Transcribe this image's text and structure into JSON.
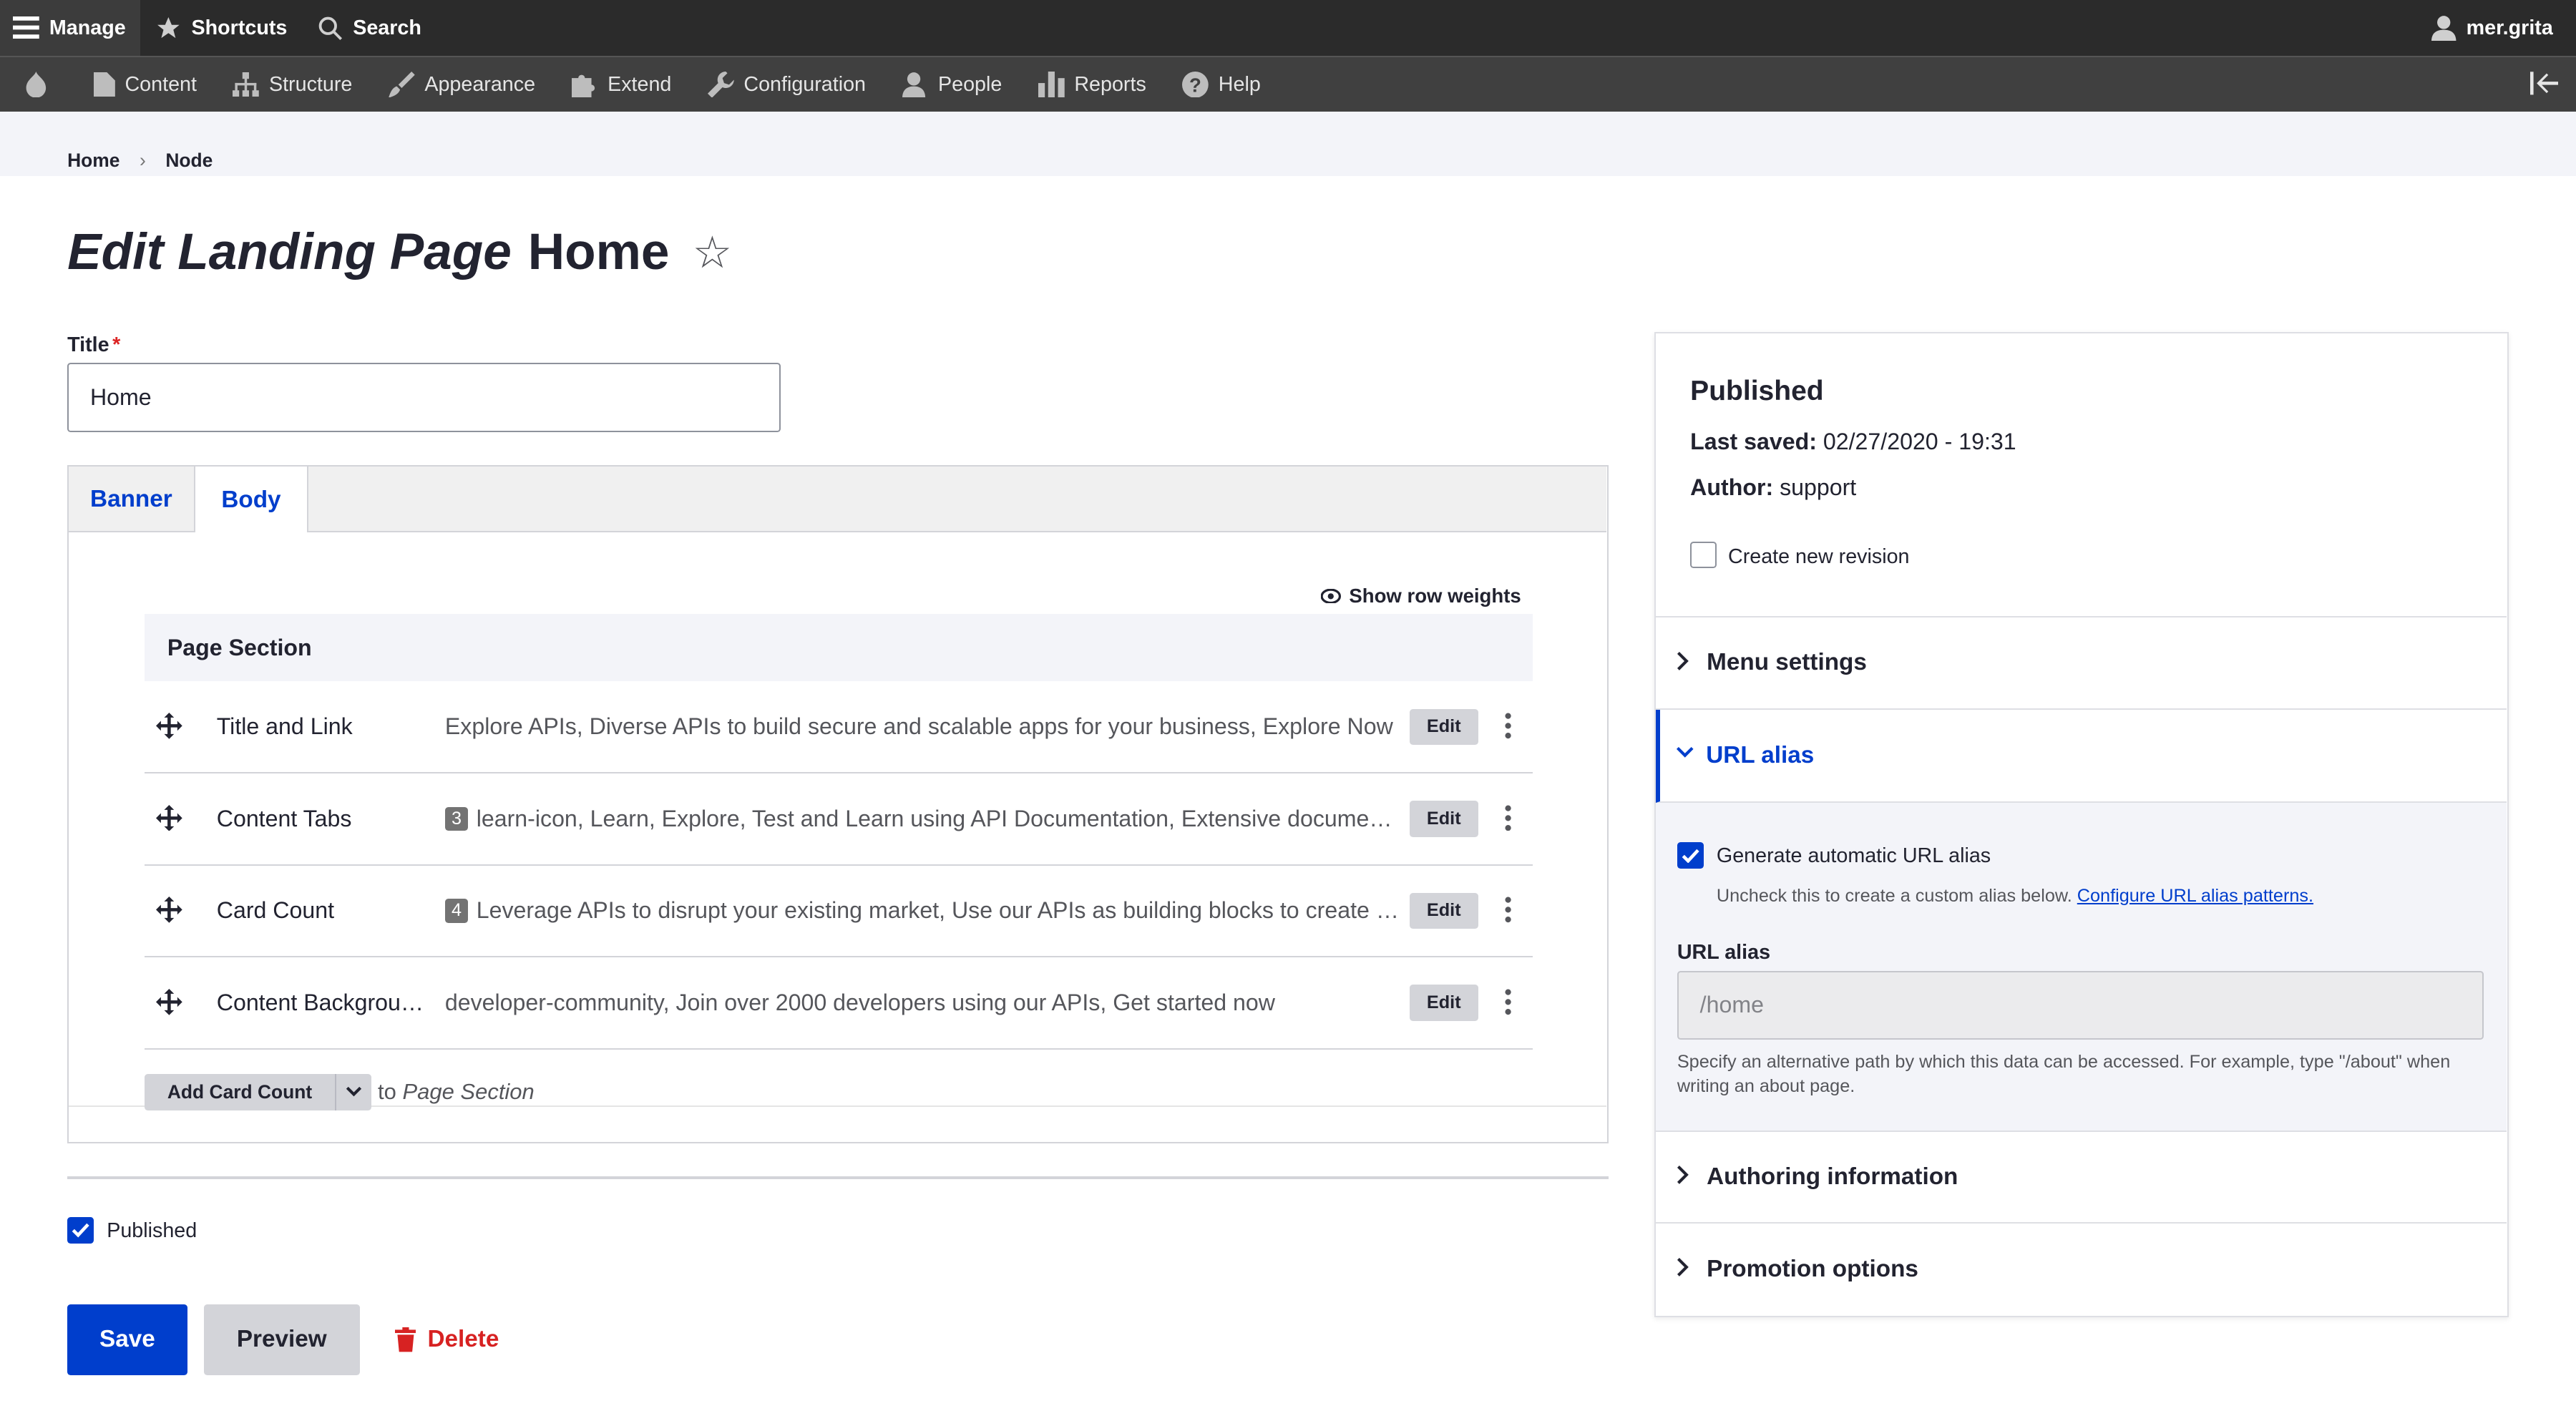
{
  "toolbar": {
    "manage": "Manage",
    "shortcuts": "Shortcuts",
    "search": "Search",
    "user": "mer.grita"
  },
  "admin_menu": [
    "Content",
    "Structure",
    "Appearance",
    "Extend",
    "Configuration",
    "People",
    "Reports",
    "Help"
  ],
  "breadcrumb": [
    "Home",
    "Node"
  ],
  "page_title": {
    "emphasis": "Edit Landing Page",
    "name": "Home"
  },
  "title_field": {
    "label": "Title",
    "required": "*",
    "value": "Home"
  },
  "tabs": [
    "Banner",
    "Body"
  ],
  "body_tab": {
    "show_row_weights": "Show row weights",
    "section_header": "Page Section",
    "rows": [
      {
        "name": "Title and Link",
        "badge": "",
        "summary": "Explore APIs, Diverse APIs to build secure and scalable apps for your business, Explore Now",
        "edit": "Edit"
      },
      {
        "name": "Content Tabs",
        "badge": "3",
        "summary": "learn-icon, Learn, Explore, Test and Learn using API Documentation, Extensive documentati...",
        "edit": "Edit"
      },
      {
        "name": "Card Count",
        "badge": "4",
        "summary": "Leverage APIs to disrupt your existing market, Use our APIs as building blocks to create ga...",
        "edit": "Edit"
      },
      {
        "name": "Content Backgroun...",
        "badge": "",
        "summary": "developer-community, Join over 2000 developers using our APIs, Get started now",
        "edit": "Edit"
      }
    ],
    "add_button": "Add Card Count",
    "add_suffix_to": "to",
    "add_suffix_target": "Page Section"
  },
  "published_checkbox": "Published",
  "actions": {
    "save": "Save",
    "preview": "Preview",
    "delete": "Delete"
  },
  "sidebar": {
    "status": "Published",
    "last_saved_label": "Last saved:",
    "last_saved_value": "02/27/2020 - 19:31",
    "author_label": "Author:",
    "author_value": "support",
    "new_revision": "Create new revision",
    "menu_settings": "Menu settings",
    "url_alias_section": "URL alias",
    "generate_alias": "Generate automatic URL alias",
    "generate_help": "Uncheck this to create a custom alias below.",
    "configure_link": "Configure URL alias patterns.",
    "url_alias_label": "URL alias",
    "url_alias_placeholder": "/home",
    "url_alias_help": "Specify an alternative path by which this data can be accessed. For example, type \"/about\" when writing an about page.",
    "authoring_info": "Authoring information",
    "promotion_options": "Promotion options"
  },
  "colors": {
    "accent": "#003ecc",
    "danger": "#d72222",
    "toolbar": "#2b2b2b",
    "tray": "#404040"
  }
}
